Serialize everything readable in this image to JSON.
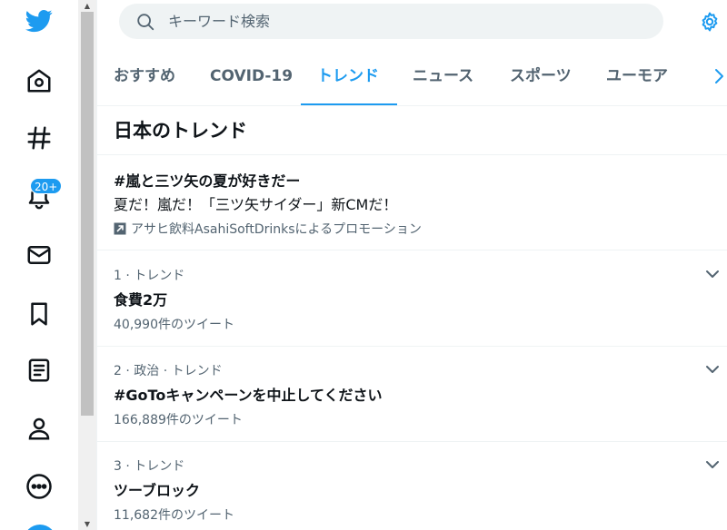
{
  "search": {
    "placeholder": "キーワード検索"
  },
  "notifications": {
    "badge": "20+"
  },
  "tabs": [
    {
      "label": "おすすめ",
      "active": false
    },
    {
      "label": "COVID-19",
      "active": false
    },
    {
      "label": "トレンド",
      "active": true
    },
    {
      "label": "ニュース",
      "active": false
    },
    {
      "label": "スポーツ",
      "active": false
    },
    {
      "label": "ユーモア",
      "active": false
    }
  ],
  "section": {
    "title": "日本のトレンド"
  },
  "promoted": {
    "hashtag": "#嵐と三ツ矢の夏が好きだー",
    "description": "夏だ！嵐だ！「三ツ矢サイダー」新CMだ！",
    "sponsor": "アサヒ飲料AsahiSoftDrinksによるプロモーション"
  },
  "trends": [
    {
      "meta": "1 · トレンド",
      "name": "食費2万",
      "count": "40,990件のツイート"
    },
    {
      "meta": "2 · 政治 · トレンド",
      "name": "#GoToキャンペーンを中止してください",
      "count": "166,889件のツイート"
    },
    {
      "meta": "3 · トレンド",
      "name": "ツーブロック",
      "count": "11,682件のツイート"
    }
  ],
  "colors": {
    "accent": "#1d9bf0",
    "text": "#0f1419",
    "secondary": "#536471"
  }
}
